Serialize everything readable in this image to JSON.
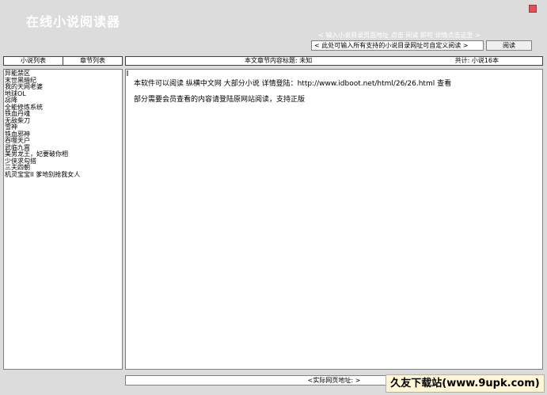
{
  "window": {
    "title": "在线小说阅读器"
  },
  "toolbar": {
    "url_hint": "< 输入小说目录页面地址 点击 阅读 即可 详情点击这里 >",
    "url_input_value": "< 此处可输入所有支持的小说目录网址可自定义阅读 >",
    "read_button_label": "阅读"
  },
  "tabs": {
    "novel_list_label": "小说列表",
    "chapter_list_label": "章节列表"
  },
  "content_header": {
    "title_label": "本文章节内容标题: 未知",
    "total_label": "共计: 小说16本"
  },
  "novel_list": {
    "items": [
      "异能禁区",
      "末世黑暗纪",
      "我的天网老婆",
      "地球OL",
      "惢降",
      "全能修炼系统",
      "铁血丹魂",
      "无敌柴刀",
      "雪神",
      "铁血邪神",
      "吞噬天户",
      "武临九霄",
      "美男龙王，妃要破你相",
      "少侠求勾搭",
      "三夫四朝",
      "机灵宝宝II 爹地别抢我女人"
    ]
  },
  "content": {
    "line1": "本软件可以阅读 纵横中文网 大部分小说 详情登陆：http://www.idboot.net/html/26/26.html 查看",
    "line2": "部分需要会员查看的内容请登陆原网站阅读，支持正版"
  },
  "status": {
    "address_label": "<实际网页地址: >"
  },
  "watermark": {
    "text": "久友下载站(www.9upk.com)"
  },
  "colors": {
    "background": "#dcdcdc",
    "panel": "#ffffff",
    "title_text": "#ffffff",
    "close_button": "#e05050"
  }
}
